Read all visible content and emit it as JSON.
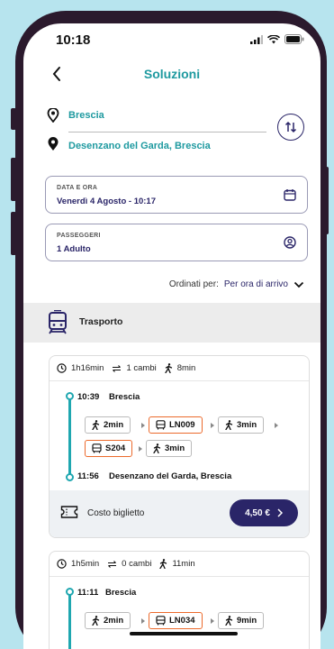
{
  "status": {
    "time": "10:18"
  },
  "header": {
    "title": "Soluzioni"
  },
  "route": {
    "from": "Brescia",
    "to": "Desenzano del Garda, Brescia"
  },
  "date_field": {
    "label": "DATA E ORA",
    "value": "Venerdì 4 Agosto - 10:17"
  },
  "passengers_field": {
    "label": "PASSEGGERI",
    "value": "1 Adulto"
  },
  "sort": {
    "label": "Ordinati per:",
    "value": "Per ora di arrivo"
  },
  "section": {
    "title": "Trasporto"
  },
  "solutions": [
    {
      "duration": "1h16min",
      "changes": "1 cambi",
      "walk": "8min",
      "departure_time": "10:39",
      "departure_stop": "Brescia",
      "arrival_time": "11:56",
      "arrival_stop": "Desenzano del Garda, Brescia",
      "legs": [
        "2min",
        "LN009",
        "3min",
        "S204",
        "3min"
      ],
      "cost_label": "Costo biglietto",
      "price": "4,50 €"
    },
    {
      "duration": "1h5min",
      "changes": "0 cambi",
      "walk": "11min",
      "departure_time": "11:11",
      "departure_stop": "Brescia",
      "legs": [
        "2min",
        "LN034",
        "9min"
      ]
    }
  ],
  "colors": {
    "accent": "#1f9aa0",
    "primary": "#2a2568",
    "bus": "#ec6a2c",
    "frame": "#2b1a2d"
  }
}
